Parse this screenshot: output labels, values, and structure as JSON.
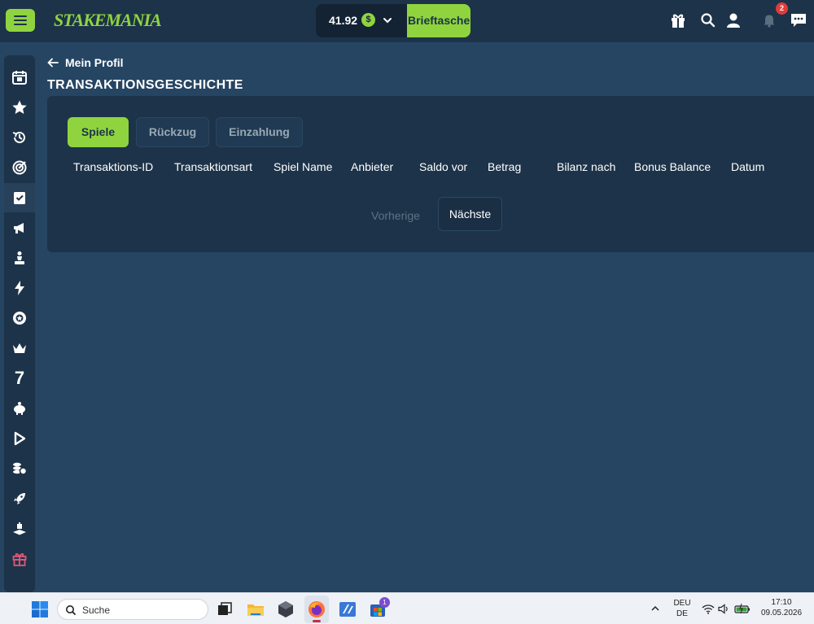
{
  "header": {
    "logo_text": "STAKEMANIA",
    "balance": "41.92",
    "currency_symbol": "$",
    "wallet_button": "Brieftasche",
    "notification_count": "2"
  },
  "page": {
    "back_label": "Mein Profil",
    "title": "TRANSAKTIONSGESCHICHTE"
  },
  "tabs": [
    {
      "label": "Spiele",
      "active": true
    },
    {
      "label": "Rückzug",
      "active": false
    },
    {
      "label": "Einzahlung",
      "active": false
    }
  ],
  "table": {
    "columns": [
      "Transaktions-ID",
      "Transaktionsart",
      "Spiel Name",
      "Anbieter",
      "Saldo vor",
      "Betrag",
      "Bilanz nach",
      "Bonus Balance",
      "Datum"
    ],
    "rows": []
  },
  "pagination": {
    "prev_label": "Vorherige",
    "next_label": "Nächste"
  },
  "sidebar": {
    "items": [
      "calendar-icon",
      "star-icon",
      "history-icon",
      "target-icon",
      "checklist-icon",
      "megaphone-icon",
      "chess-icon",
      "lightning-icon",
      "poker-chip-icon",
      "crown-icon",
      "seven-icon",
      "piggy-bank-icon",
      "play-icon",
      "coins-icon",
      "rocket-icon",
      "layers-icon",
      "gift-icon"
    ],
    "active_index": 4,
    "seven_glyph": "7"
  },
  "taskbar": {
    "search_placeholder": "Suche",
    "store_badge": "1",
    "lang_top": "DEU",
    "lang_bottom": "DE",
    "time": "17:10",
    "date": "09.05.2026"
  },
  "colors": {
    "accent": "#8fd43f",
    "background": "#254563",
    "panel": "#1d3349",
    "gift_icon": "#e0577a"
  }
}
